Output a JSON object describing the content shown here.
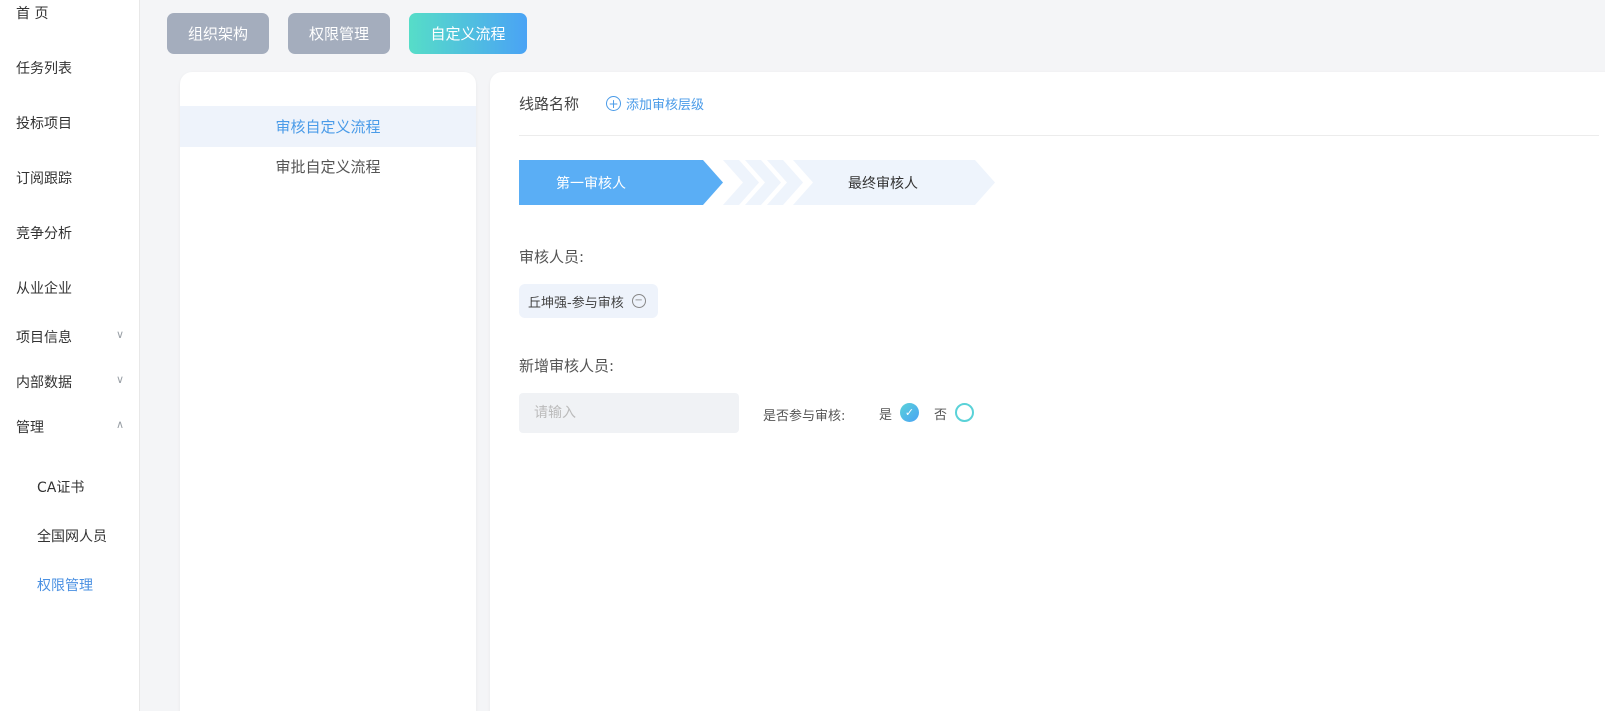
{
  "sidebar": {
    "items": [
      {
        "label": "首 页"
      },
      {
        "label": "任务列表"
      },
      {
        "label": "投标项目"
      },
      {
        "label": "订阅跟踪"
      },
      {
        "label": "竞争分析"
      },
      {
        "label": "从业企业"
      },
      {
        "label": "项目信息",
        "chevron": "down"
      },
      {
        "label": "内部数据",
        "chevron": "down"
      },
      {
        "label": "管理",
        "chevron": "up"
      }
    ],
    "sub_items": [
      {
        "label": "CA证书"
      },
      {
        "label": "全国网人员"
      },
      {
        "label": "权限管理",
        "active": true
      }
    ]
  },
  "top_tabs": [
    {
      "label": "组织架构"
    },
    {
      "label": "权限管理"
    },
    {
      "label": "自定义流程",
      "active": true
    }
  ],
  "flow_list": [
    {
      "label": "审核自定义流程",
      "active": true
    },
    {
      "label": "审批自定义流程"
    }
  ],
  "detail": {
    "route_label": "线路名称",
    "add_level_label": "添加审核层级",
    "steps": [
      {
        "label": "第一审核人",
        "active": true
      },
      {
        "label": "最终审核人"
      }
    ],
    "reviewers_label": "审核人员:",
    "reviewer_tag": "丘坤强-参与审核",
    "new_reviewer_label": "新增审核人员:",
    "input_placeholder": "请输入",
    "participate_label": "是否参与审核:",
    "option_yes": "是",
    "option_no": "否",
    "selected_option": "是"
  },
  "colors": {
    "accent": "#4a9be8",
    "step_active": "#5aaef5",
    "step_inactive": "#eef4fc",
    "tab_gray": "#a4adbd"
  }
}
